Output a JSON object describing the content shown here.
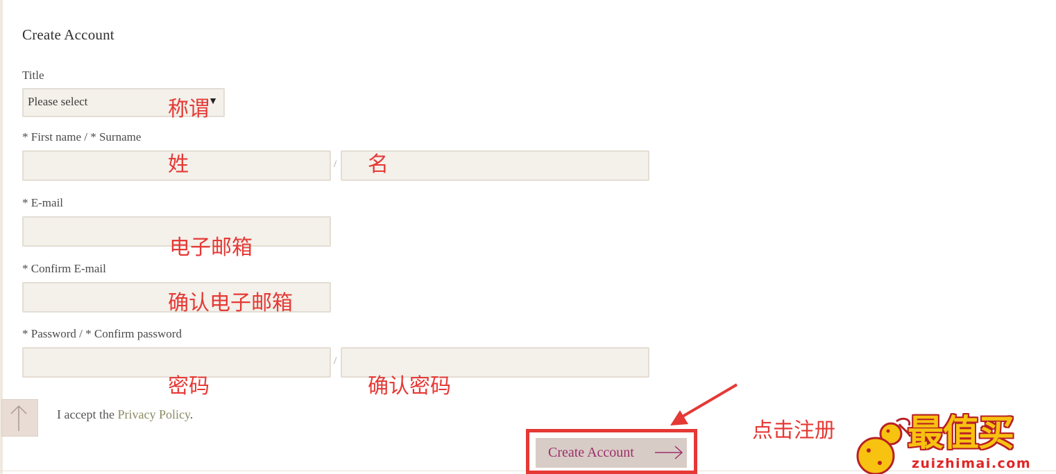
{
  "form": {
    "title": "Create Account",
    "title_field": {
      "label": "Title",
      "selected": "Please select"
    },
    "name_field": {
      "label": "* First name / * Surname",
      "separator": "/"
    },
    "email_field": {
      "label": "* E-mail"
    },
    "confirm_email_field": {
      "label": "* Confirm E-mail"
    },
    "password_field": {
      "label": "* Password / * Confirm password",
      "separator": "/"
    },
    "privacy": {
      "prefix": "I accept the ",
      "link": "Privacy Policy",
      "suffix": "."
    },
    "submit_label": "Create Account"
  },
  "annotations": {
    "title": "称谓",
    "first_name": "姓",
    "surname": "名",
    "email": "电子邮箱",
    "confirm_email": "确认电子邮箱",
    "password": "密码",
    "confirm_password": "确认密码",
    "click_register": "点击注册"
  },
  "watermark": {
    "title": "最值买",
    "domain": "zuizhimai.com"
  },
  "colors": {
    "background": "#ffffff",
    "input_fill": "#f4f0ea",
    "button_fill": "#d8ccc6",
    "button_text": "#9c2f6b",
    "link_text": "#8a8a63",
    "annotation_red": "#e53935",
    "logo_yellow": "#f7c210"
  },
  "icons": {
    "select_arrow": "caret-down-icon",
    "scroll_top": "arrow-up-icon",
    "button_arrow": "arrow-right-icon",
    "annotation_arrow": "pointer-arrow-icon"
  }
}
